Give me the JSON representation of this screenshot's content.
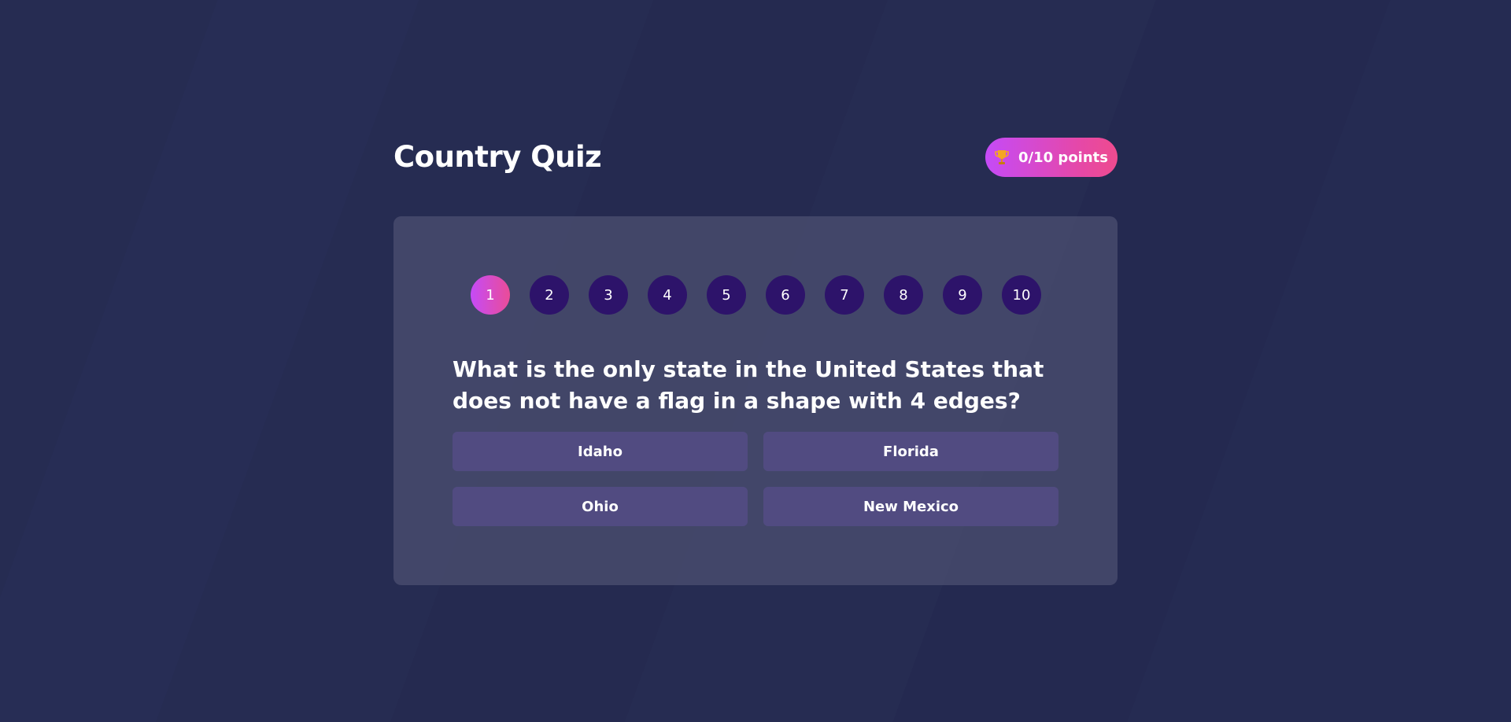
{
  "app": {
    "title": "Country Quiz"
  },
  "score": {
    "icon": "trophy-icon",
    "label": "0/10 points"
  },
  "progress": {
    "current": 1,
    "steps": [
      "1",
      "2",
      "3",
      "4",
      "5",
      "6",
      "7",
      "8",
      "9",
      "10"
    ]
  },
  "question": {
    "text": "What is the only state in the United States that does not have a flag in a shape with 4 edges?"
  },
  "answers": [
    "Idaho",
    "Florida",
    "Ohio",
    "New Mexico"
  ],
  "colors": {
    "background": "#24294f",
    "card": "#3e4264",
    "step": "#2d136a",
    "accent_start": "#c54bf7",
    "accent_end": "#ee4b8e",
    "answer": "#4a4873"
  }
}
